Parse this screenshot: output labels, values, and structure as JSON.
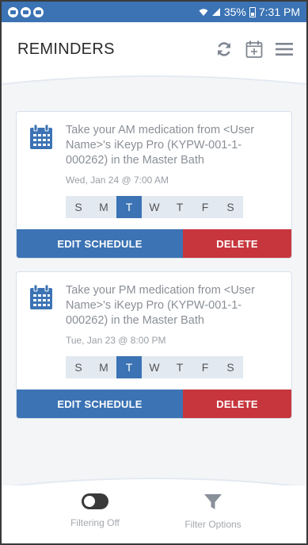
{
  "status_bar": {
    "battery": "35%",
    "time": "7:31 PM"
  },
  "header": {
    "title": "REMINDERS",
    "icons": [
      "refresh-icon",
      "calendar-add-icon",
      "menu-icon"
    ]
  },
  "reminders": [
    {
      "message": "Take your AM medication from <User Name>'s iKeyp Pro (KYPW-001-1-000262) in the Master Bath",
      "when": "Wed, Jan 24 @ 7:00 AM",
      "days": [
        "S",
        "M",
        "T",
        "W",
        "T",
        "F",
        "S"
      ],
      "active_day": 2,
      "edit_label": "EDIT SCHEDULE",
      "delete_label": "DELETE"
    },
    {
      "message": "Take your PM medication from <User Name>'s iKeyp Pro (KYPW-001-1-000262) in the Master Bath",
      "when": "Tue, Jan 23 @ 8:00 PM",
      "days": [
        "S",
        "M",
        "T",
        "W",
        "T",
        "F",
        "S"
      ],
      "active_day": 2,
      "edit_label": "EDIT SCHEDULE",
      "delete_label": "DELETE"
    }
  ],
  "footer": {
    "filtering_label": "Filtering Off",
    "filter_options_label": "Filter Options"
  },
  "colors": {
    "primary": "#3b73b4",
    "danger": "#c7363d"
  }
}
